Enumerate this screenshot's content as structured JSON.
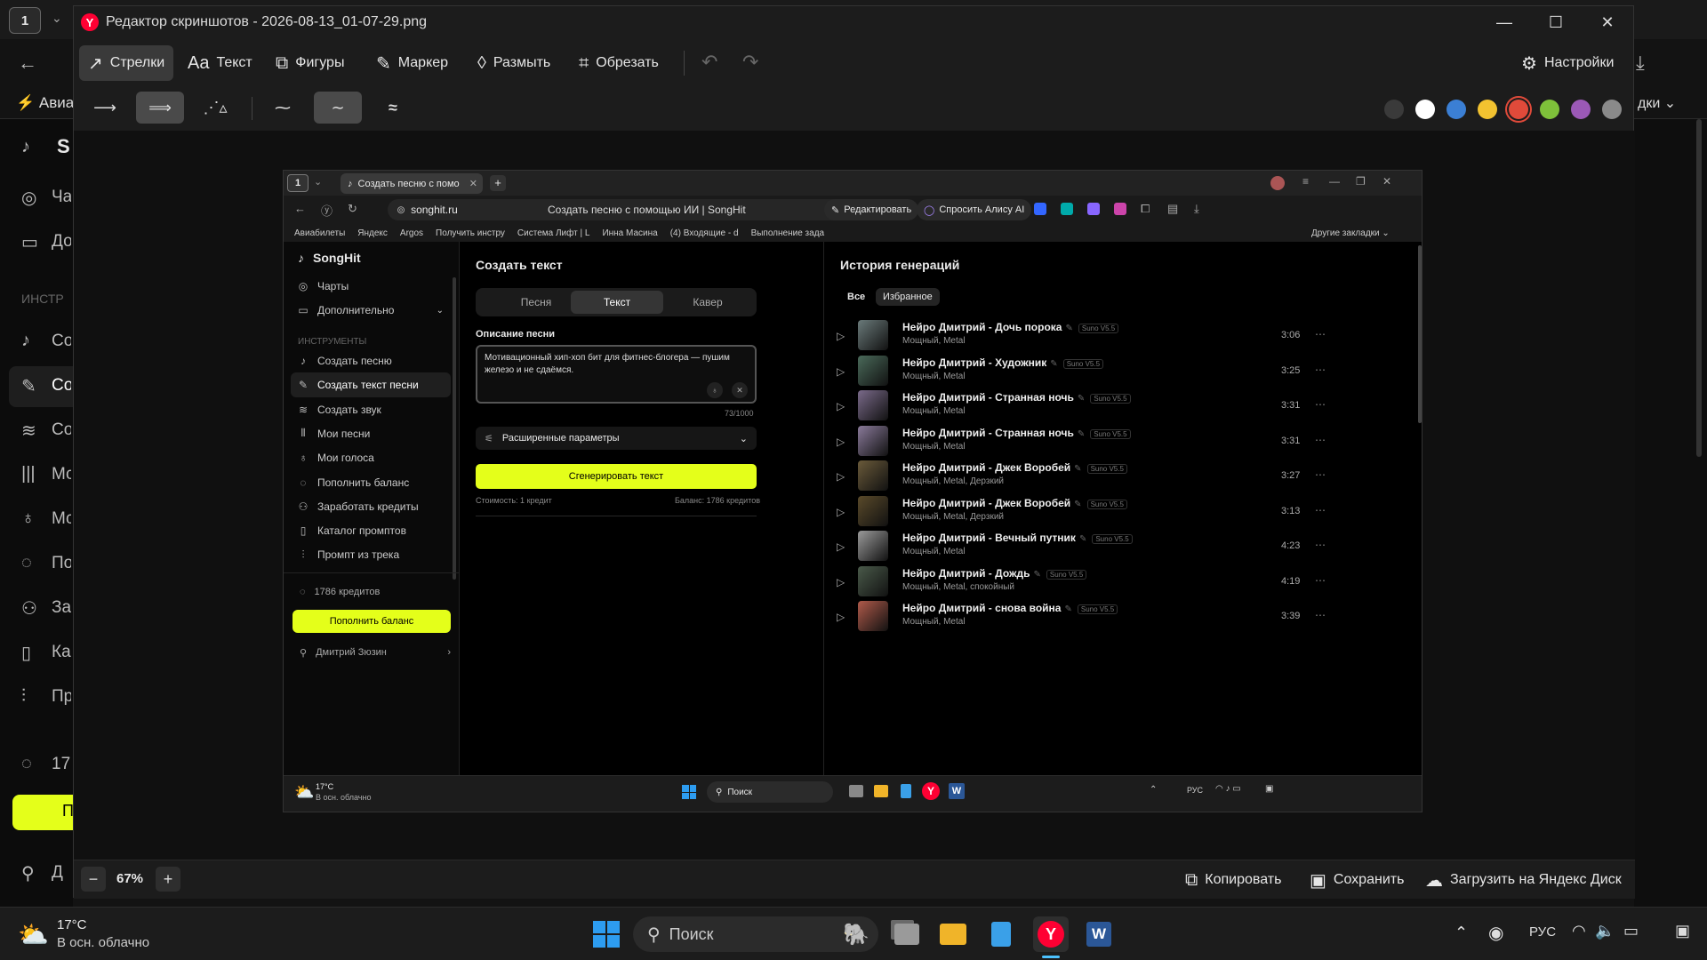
{
  "background_browser": {
    "tab_number": "1",
    "bookmark_first": "Авиа",
    "bookmark_right": "дки",
    "sidebar_logo": "S",
    "sidebar_items": [
      "Ча",
      "До",
      "Со",
      "Со",
      "Со",
      "Мс",
      "Мс",
      "По",
      "За",
      "Ка",
      "Пр"
    ],
    "sidebar_section": "ИНСТР",
    "credits_prefix": "17",
    "balance_btn_prefix": "П",
    "user_prefix": "Д"
  },
  "editor": {
    "title": "Редактор скриншотов - 2026-08-13_01-07-29.png",
    "tools": [
      {
        "label": "Стрелки",
        "icon": "arrow-icon",
        "active": true
      },
      {
        "label": "Текст",
        "icon": "text-icon",
        "active": false
      },
      {
        "label": "Фигуры",
        "icon": "shapes-icon",
        "active": false
      },
      {
        "label": "Маркер",
        "icon": "marker-icon",
        "active": false
      },
      {
        "label": "Размыть",
        "icon": "blur-icon",
        "active": false
      },
      {
        "label": "Обрезать",
        "icon": "crop-icon",
        "active": false
      }
    ],
    "settings_label": "Настройки",
    "colors": [
      "#3a3a3a",
      "#ffffff",
      "#3b7fd4",
      "#f2c230",
      "#e04a3a",
      "#7ec13a",
      "#9b59b6",
      "#8a8a8a"
    ],
    "selected_color_index": 4,
    "zoom": "67%",
    "copy_label": "Копировать",
    "save_label": "Сохранить",
    "upload_label": "Загрузить на Яндекс Диск"
  },
  "inner": {
    "tab_number": "1",
    "tab_title": "Создать песню с помо",
    "url_domain": "songhit.ru",
    "page_title": "Создать песню с помощью ИИ | SongHit",
    "edit_btn": "Редактировать",
    "alice_btn": "Спросить Алису AI",
    "bookmarks": [
      "Авиабилеты",
      "Яндекс",
      "Argos",
      "Получить инстру",
      "Система Лифт | L",
      "Инна Масина",
      "(4) Входящие - d",
      "Выполнение зада"
    ],
    "other_bookmarks": "Другие закладки",
    "brand": "SongHit",
    "nav": [
      {
        "label": "Чарты",
        "icon": "globe-icon"
      },
      {
        "label": "Дополнительно",
        "icon": "folder-icon"
      }
    ],
    "tools_section": "ИНСТРУМЕНТЫ",
    "tools": [
      {
        "label": "Создать песню",
        "icon": "music-note-icon",
        "active": false
      },
      {
        "label": "Создать текст песни",
        "icon": "pen-icon",
        "active": true
      },
      {
        "label": "Создать звук",
        "icon": "wave-icon",
        "active": false
      },
      {
        "label": "Мои песни",
        "icon": "library-icon",
        "active": false
      },
      {
        "label": "Мои голоса",
        "icon": "mic-icon",
        "active": false
      },
      {
        "label": "Пополнить баланс",
        "icon": "coins-icon",
        "active": false
      },
      {
        "label": "Заработать кредиты",
        "icon": "user-plus-icon",
        "active": false
      },
      {
        "label": "Каталог промптов",
        "icon": "book-icon",
        "active": false
      },
      {
        "label": "Промпт из трека",
        "icon": "audio-icon",
        "active": false
      }
    ],
    "credits": "1786 кредитов",
    "topup_btn": "Пополнить баланс",
    "user_name": "Дмитрий Зюзин",
    "create_title": "Создать текст",
    "modes": [
      "Песня",
      "Текст",
      "Кавер"
    ],
    "active_mode": 1,
    "desc_label": "Описание песни",
    "desc_value": "Мотивационный хип-хоп бит для фитнес-блогера — пушим железо и не сдаёмся.",
    "char_count": "73/1000",
    "advanced": "Расширенные параметры",
    "generate_btn": "Сгенерировать текст",
    "cost": "Стоимость: 1 кредит",
    "balance": "Баланс: 1786 кредитов",
    "history_title": "История генераций",
    "history_tabs": [
      "Все",
      "Избранное"
    ],
    "history": [
      {
        "title": "Нейро Дмитрий - Дочь порока",
        "tags": "Мощный, Metal",
        "time": "3:06",
        "thumb": "#6a7a7a"
      },
      {
        "title": "Нейро Дмитрий - Художник",
        "tags": "Мощный, Metal",
        "time": "3:25",
        "thumb": "#4a6a5a"
      },
      {
        "title": "Нейро Дмитрий - Странная ночь",
        "tags": "Мощный, Metal",
        "time": "3:31",
        "thumb": "#7a6a8a"
      },
      {
        "title": "Нейро Дмитрий - Странная ночь",
        "tags": "Мощный, Metal",
        "time": "3:31",
        "thumb": "#8a7a9a"
      },
      {
        "title": "Нейро Дмитрий - Джек Воробей",
        "tags": "Мощный, Metal, Дерзкий",
        "time": "3:27",
        "thumb": "#6a5a3a"
      },
      {
        "title": "Нейро Дмитрий - Джек Воробей",
        "tags": "Мощный, Metal, Дерзкий",
        "time": "3:13",
        "thumb": "#5a4a2a"
      },
      {
        "title": "Нейро Дмитрий - Вечный путник",
        "tags": "Мощный, Metal",
        "time": "4:23",
        "thumb": "#9a9a9a"
      },
      {
        "title": "Нейро Дмитрий - Дождь",
        "tags": "Мощный, Metal, спокойный",
        "time": "4:19",
        "thumb": "#4a5a4a"
      },
      {
        "title": "Нейро Дмитрий - снова война",
        "tags": "Мощный, Metal",
        "time": "3:39",
        "thumb": "#b05a4a"
      }
    ],
    "badge": "Suno V5.5",
    "weather_temp": "17°C",
    "weather_desc": "В осн. облачно",
    "search": "Поиск",
    "lang": "РУС"
  },
  "taskbar": {
    "weather_temp": "17°C",
    "weather_desc": "В осн. облачно",
    "search_placeholder": "Поиск",
    "lang": "РУС"
  }
}
